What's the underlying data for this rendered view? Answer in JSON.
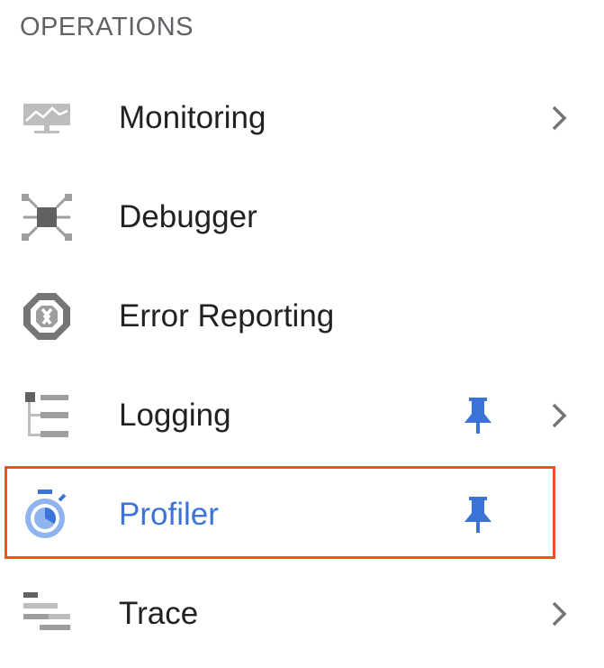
{
  "section": {
    "title": "OPERATIONS"
  },
  "items": [
    {
      "label": "Monitoring",
      "icon": "monitoring-icon",
      "pinned": false,
      "has_submenu": true
    },
    {
      "label": "Debugger",
      "icon": "debugger-icon",
      "pinned": false,
      "has_submenu": false
    },
    {
      "label": "Error Reporting",
      "icon": "error-reporting-icon",
      "pinned": false,
      "has_submenu": false
    },
    {
      "label": "Logging",
      "icon": "logging-icon",
      "pinned": true,
      "has_submenu": true
    },
    {
      "label": "Profiler",
      "icon": "profiler-icon",
      "pinned": true,
      "has_submenu": false,
      "active": true
    },
    {
      "label": "Trace",
      "icon": "trace-icon",
      "pinned": false,
      "has_submenu": true
    }
  ],
  "colors": {
    "header_text": "#5f6368",
    "item_text": "#202124",
    "active_text": "#3b73d9",
    "pin": "#3b73d9",
    "chevron": "#757575",
    "icon_gray": "#9e9e9e",
    "highlight": "#f4511e"
  }
}
